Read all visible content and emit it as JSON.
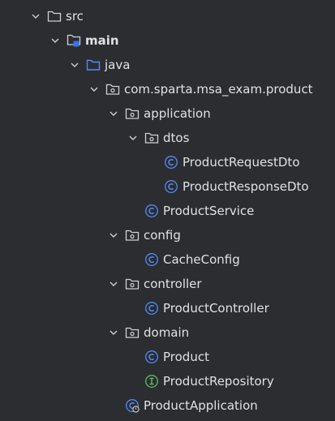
{
  "tree": {
    "items": [
      {
        "label": "src",
        "type": "folder",
        "expanded": true,
        "depth": 0
      },
      {
        "label": "main",
        "type": "source-folder",
        "expanded": true,
        "depth": 1,
        "bold": true
      },
      {
        "label": "java",
        "type": "java-folder",
        "expanded": true,
        "depth": 2
      },
      {
        "label": "com.sparta.msa_exam.product",
        "type": "package",
        "expanded": true,
        "depth": 3
      },
      {
        "label": "application",
        "type": "package",
        "expanded": true,
        "depth": 4
      },
      {
        "label": "dtos",
        "type": "package",
        "expanded": true,
        "depth": 5
      },
      {
        "label": "ProductRequestDto",
        "type": "class",
        "depth": 6
      },
      {
        "label": "ProductResponseDto",
        "type": "class",
        "depth": 6
      },
      {
        "label": "ProductService",
        "type": "class",
        "depth": 5
      },
      {
        "label": "config",
        "type": "package",
        "expanded": true,
        "depth": 4
      },
      {
        "label": "CacheConfig",
        "type": "class",
        "depth": 5
      },
      {
        "label": "controller",
        "type": "package",
        "expanded": true,
        "depth": 4
      },
      {
        "label": "ProductController",
        "type": "class",
        "depth": 5
      },
      {
        "label": "domain",
        "type": "package",
        "expanded": true,
        "depth": 4
      },
      {
        "label": "Product",
        "type": "class",
        "depth": 5
      },
      {
        "label": "ProductRepository",
        "type": "interface",
        "depth": 5
      },
      {
        "label": "ProductApplication",
        "type": "spring-class",
        "depth": 4
      }
    ]
  },
  "colors": {
    "background": "#2b2d30",
    "text": "#dfe1e5",
    "folder": "#ced0d6",
    "class": "#548af7",
    "interface": "#5fb865",
    "source-folder": "#3574f0"
  }
}
